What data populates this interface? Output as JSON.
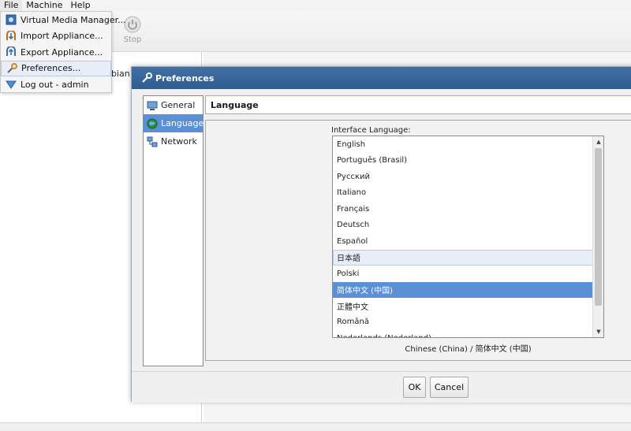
{
  "menubar": {
    "items": [
      "File",
      "Machine",
      "Help"
    ]
  },
  "toolbar": {
    "stop_label": "Stop"
  },
  "background": {
    "vm_label_fragment": "bian"
  },
  "file_menu": {
    "items": [
      {
        "label": "Virtual Media Manager...",
        "icon": "media-manager-icon"
      },
      {
        "label": "Import Appliance...",
        "icon": "import-icon"
      },
      {
        "label": "Export Appliance...",
        "icon": "export-icon"
      },
      {
        "label": "Preferences...",
        "icon": "wrench-icon"
      },
      {
        "label": "Log out - admin",
        "icon": "logout-icon"
      }
    ],
    "highlighted": "Preferences..."
  },
  "dialog": {
    "title": "Preferences",
    "nav": [
      {
        "label": "General",
        "icon": "monitor-icon"
      },
      {
        "label": "Language",
        "icon": "globe-icon"
      },
      {
        "label": "Network",
        "icon": "network-icon"
      }
    ],
    "selected_nav": "Language",
    "section_title": "Language",
    "interface_language_label": "Interface Language:",
    "languages": [
      "English",
      "Português (Brasil)",
      "Русский",
      "Italiano",
      "Français",
      "Deutsch",
      "Español",
      "日本語",
      "Polski",
      "简体中文 (中国)",
      "正體中文",
      "Română",
      "Nederlands (Nederland)"
    ],
    "hovered_language": "日本語",
    "selected_language": "简体中文 (中国)",
    "current_language_text": "Chinese (China) / 简体中文 (中国)",
    "ok_label": "OK",
    "cancel_label": "Cancel"
  },
  "colors": {
    "title_bar": "#2f5d92",
    "selection": "#5b8fd6",
    "hover": "#e8eef7"
  }
}
